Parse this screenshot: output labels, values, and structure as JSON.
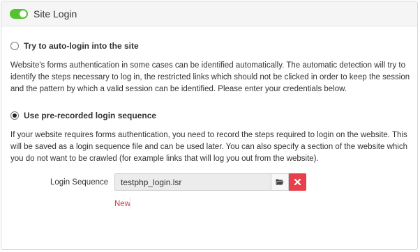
{
  "panel": {
    "title": "Site Login",
    "toggle_on": true,
    "toggle_color": "#55c233"
  },
  "options": {
    "auto": {
      "label": "Try to auto-login into the site",
      "selected": false,
      "description": "Website's forms authentication in some cases can be identified automatically. The automatic detection will try to identify the steps necessary to log in, the restricted links which should not be clicked in order to keep the session and the pattern by which a valid session can be identified. Please enter your credentials below."
    },
    "prerecorded": {
      "label": "Use pre-recorded login sequence",
      "selected": true,
      "description": "If your website requires forms authentication, you need to record the steps required to login on the website. This will be saved as a login sequence file and can be used later. You can also specify a section of the website which you do not want to be crawled (for example links that will log you out from the website)."
    }
  },
  "login_sequence": {
    "label": "Login Sequence",
    "value": "testphp_login.lsr",
    "browse_icon": "folder-open-icon",
    "clear_icon": "close-icon",
    "clear_color": "#e8404a",
    "new_label": "New",
    "new_color": "#d43a3a"
  }
}
